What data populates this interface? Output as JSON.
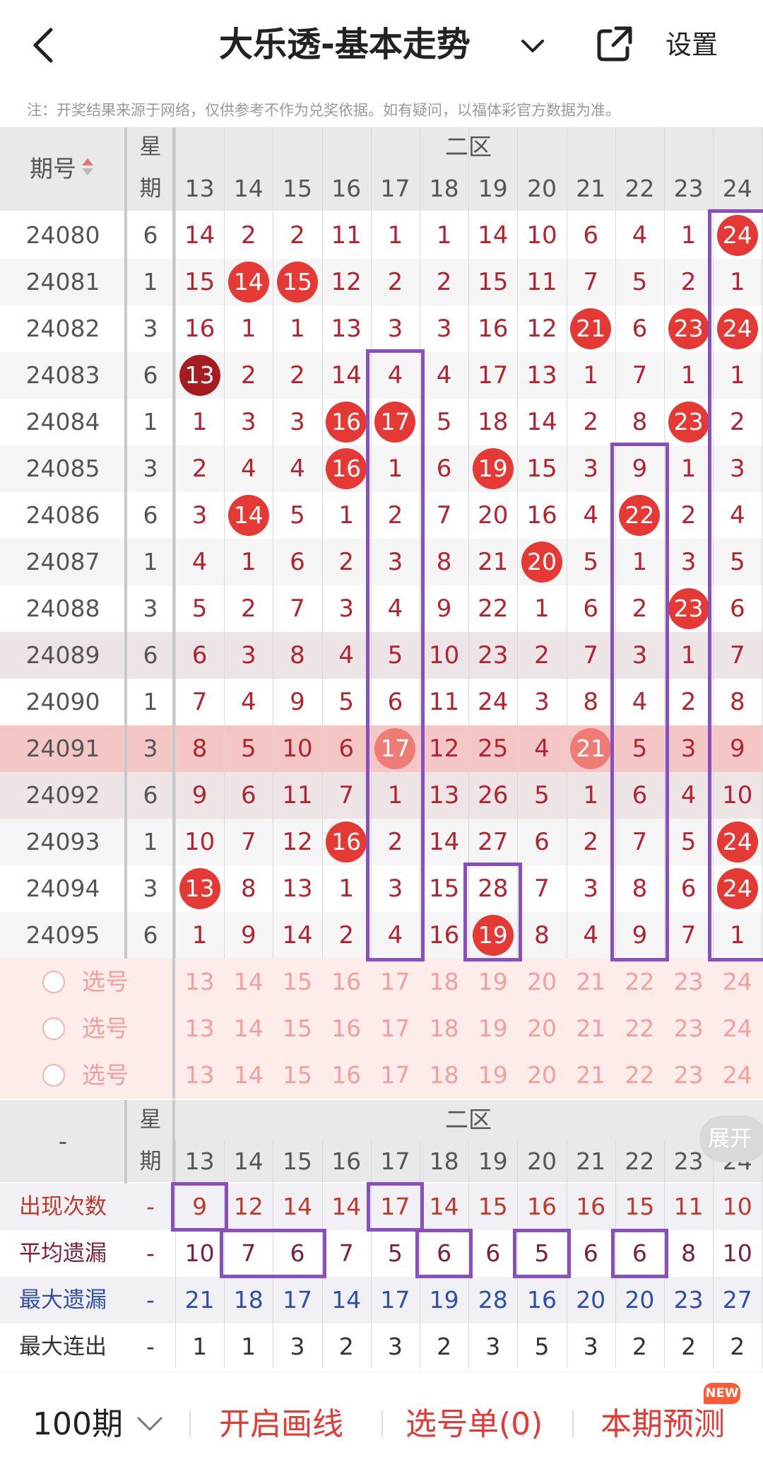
{
  "header": {
    "back_icon": "chevron-left-icon",
    "title": "大乐透-基本走势",
    "share_icon": "share-icon",
    "settings_label": "设置"
  },
  "notice": "注：开奖结果来源于网络，仅供参考不作为兑奖依据。如有疑问，以福体彩官方数据为准。",
  "table": {
    "period_header": "期号",
    "week_header_top": "星",
    "week_header_bottom": "期",
    "zone_label": "二区",
    "columns": [
      "13",
      "14",
      "15",
      "16",
      "17",
      "18",
      "19",
      "20",
      "21",
      "22",
      "23",
      "24"
    ],
    "rows": [
      {
        "id": "24080",
        "week": "6",
        "values": [
          "14",
          "2",
          "2",
          "11",
          "1",
          "1",
          "14",
          "10",
          "6",
          "4",
          "1",
          "24"
        ]
      },
      {
        "id": "24081",
        "week": "1",
        "values": [
          "15",
          "14",
          "15",
          "12",
          "2",
          "2",
          "15",
          "11",
          "7",
          "5",
          "2",
          "1"
        ]
      },
      {
        "id": "24082",
        "week": "3",
        "values": [
          "16",
          "1",
          "1",
          "13",
          "3",
          "3",
          "16",
          "12",
          "21",
          "6",
          "23",
          "24"
        ]
      },
      {
        "id": "24083",
        "week": "6",
        "values": [
          "13",
          "2",
          "2",
          "14",
          "4",
          "4",
          "17",
          "13",
          "1",
          "7",
          "1",
          "1"
        ]
      },
      {
        "id": "24084",
        "week": "1",
        "values": [
          "1",
          "3",
          "3",
          "16",
          "17",
          "5",
          "18",
          "14",
          "2",
          "8",
          "23",
          "2"
        ]
      },
      {
        "id": "24085",
        "week": "3",
        "values": [
          "2",
          "4",
          "4",
          "16",
          "1",
          "6",
          "19",
          "15",
          "3",
          "9",
          "1",
          "3"
        ]
      },
      {
        "id": "24086",
        "week": "6",
        "values": [
          "3",
          "14",
          "5",
          "1",
          "2",
          "7",
          "20",
          "16",
          "4",
          "22",
          "2",
          "4"
        ]
      },
      {
        "id": "24087",
        "week": "1",
        "values": [
          "4",
          "1",
          "6",
          "2",
          "3",
          "8",
          "21",
          "20",
          "5",
          "1",
          "3",
          "5"
        ]
      },
      {
        "id": "24088",
        "week": "3",
        "values": [
          "5",
          "2",
          "7",
          "3",
          "4",
          "9",
          "22",
          "1",
          "6",
          "2",
          "23",
          "6"
        ]
      },
      {
        "id": "24089",
        "week": "6",
        "values": [
          "6",
          "3",
          "8",
          "4",
          "5",
          "10",
          "23",
          "2",
          "7",
          "3",
          "1",
          "7"
        ]
      },
      {
        "id": "24090",
        "week": "1",
        "values": [
          "7",
          "4",
          "9",
          "5",
          "6",
          "11",
          "24",
          "3",
          "8",
          "4",
          "2",
          "8"
        ]
      },
      {
        "id": "24091",
        "week": "3",
        "values": [
          "8",
          "5",
          "10",
          "6",
          "17",
          "12",
          "25",
          "4",
          "21",
          "5",
          "3",
          "9"
        ]
      },
      {
        "id": "24092",
        "week": "6",
        "values": [
          "9",
          "6",
          "11",
          "7",
          "1",
          "13",
          "26",
          "5",
          "1",
          "6",
          "4",
          "10"
        ]
      },
      {
        "id": "24093",
        "week": "1",
        "values": [
          "10",
          "7",
          "12",
          "16",
          "2",
          "14",
          "27",
          "6",
          "2",
          "7",
          "5",
          "24"
        ]
      },
      {
        "id": "24094",
        "week": "3",
        "values": [
          "13",
          "8",
          "13",
          "1",
          "3",
          "15",
          "28",
          "7",
          "3",
          "8",
          "6",
          "24"
        ]
      },
      {
        "id": "24095",
        "week": "6",
        "values": [
          "1",
          "9",
          "14",
          "2",
          "4",
          "16",
          "19",
          "8",
          "4",
          "9",
          "7",
          "1"
        ]
      }
    ],
    "pick_label": "选号",
    "stats_header_dash": "-",
    "stats": [
      {
        "label": "出现次数",
        "week": "-",
        "color": "#c0392b",
        "values": [
          "9",
          "12",
          "14",
          "14",
          "17",
          "14",
          "15",
          "16",
          "16",
          "15",
          "11",
          "10"
        ]
      },
      {
        "label": "平均遗漏",
        "week": "-",
        "color": "#7b1f3a",
        "values": [
          "10",
          "7",
          "6",
          "7",
          "5",
          "6",
          "6",
          "5",
          "6",
          "6",
          "8",
          "10"
        ]
      },
      {
        "label": "最大遗漏",
        "week": "-",
        "color": "#2f4fa8",
        "values": [
          "21",
          "18",
          "17",
          "14",
          "17",
          "19",
          "28",
          "16",
          "20",
          "20",
          "23",
          "27"
        ]
      },
      {
        "label": "最大连出",
        "week": "-",
        "color": "#333333",
        "values": [
          "1",
          "1",
          "3",
          "2",
          "3",
          "2",
          "3",
          "5",
          "3",
          "2",
          "2",
          "2"
        ]
      }
    ],
    "expand_label": "展开"
  },
  "bottom_bar": {
    "period_label": "100期",
    "draw_lines": "开启画线",
    "pick_list": "选号单(0)",
    "prediction": "本期预测",
    "new_badge": "NEW"
  },
  "colors": {
    "ball": "#e53935",
    "ball_dark": "#a51c22",
    "box": "#8a4fbf",
    "highlight_row": "#f5c6c6"
  }
}
